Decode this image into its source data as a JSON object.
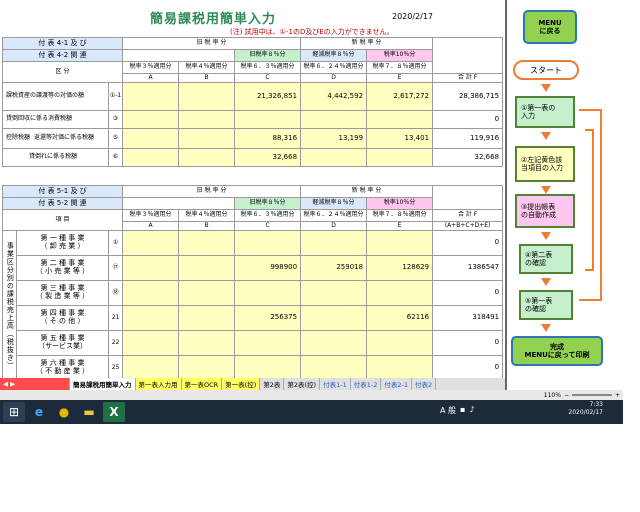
{
  "header": {
    "title": "簡易課税用簡単入力",
    "date": "2020/2/17",
    "note": "(注) 試用中は、①-1のD及びEの入力ができません。"
  },
  "table1": {
    "label_top": "付 表 4-1 及 び",
    "label_bottom": "付 表 4-2 関 連",
    "old_rate": "旧 税 率 分",
    "new_rate": "新 税 率 分",
    "old8": "旧税率８％分",
    "reduced8": "軽減税率８％分",
    "rate10": "税率10％分",
    "kubun": "区 分",
    "cols": [
      {
        "label": "税率３％適用分",
        "letter": "A"
      },
      {
        "label": "税率４％適用分",
        "letter": "B"
      },
      {
        "label": "税率６．３％適用分",
        "letter": "C"
      },
      {
        "label": "税率６．２４％適用分",
        "letter": "D"
      },
      {
        "label": "税率７．８％適用分",
        "letter": "E"
      },
      {
        "label": "合 計 F",
        "letter": "(A+B+C+D+E)"
      }
    ],
    "rows": [
      {
        "label": "課税資産の譲渡等の対価の額",
        "no": "①-1",
        "values": [
          "",
          "",
          "21,326,851",
          "4,442,592",
          "2,617,272",
          "28,386,715"
        ]
      },
      {
        "label": "貸倒回収に係る消費税額",
        "no": "③",
        "values": [
          "",
          "",
          "",
          "",
          "",
          "0"
        ]
      },
      {
        "label": "返還等対価に係る税額",
        "no": "⑤",
        "values": [
          "",
          "",
          "88,316",
          "13,199",
          "13,401",
          "119,916"
        ]
      },
      {
        "label": "貸倒れに係る税額",
        "no": "⑥",
        "values": [
          "",
          "",
          "32,668",
          "",
          "",
          "32,668"
        ]
      }
    ],
    "kojo": "控除税額"
  },
  "table2": {
    "label_top": "付 表 5-1 及 び",
    "label_bottom": "付 表 5-2 関 連",
    "kou": "項 目",
    "side_label": "事業区分別の課税売上高（税抜き）",
    "rows": [
      {
        "label1": "第 一 種 事 業",
        "label2": "（ 卸 売 業 ）",
        "no": "①",
        "values": [
          "",
          "",
          "",
          "",
          "",
          "0"
        ]
      },
      {
        "label1": "第 二 種 事 業",
        "label2": "（ 小 売 業 等 ）",
        "no": "⑰",
        "values": [
          "",
          "",
          "998900",
          "259018",
          "128629",
          "1386547"
        ]
      },
      {
        "label1": "第 三 種 事 業",
        "label2": "（ 製 造 業 等 ）",
        "no": "⑱",
        "values": [
          "",
          "",
          "",
          "",
          "",
          "0"
        ]
      },
      {
        "label1": "第 四 種 事 業",
        "label2": "（ そ の 他 ）",
        "no": "21",
        "values": [
          "",
          "",
          "256375",
          "",
          "62116",
          "318491"
        ]
      },
      {
        "label1": "第 五 種 事 業",
        "label2": "（サービス業）",
        "no": "22",
        "values": [
          "",
          "",
          "",
          "",
          "",
          "0"
        ]
      },
      {
        "label1": "第 六 種 事 業",
        "label2": "（ 不 動 産 業 ）",
        "no": "25",
        "values": [
          "",
          "",
          "",
          "",
          "",
          "0"
        ]
      }
    ]
  },
  "panel": {
    "menu_btn": "MENU\nに戻る",
    "start": "スタート",
    "step1": "①第一表の\n入力",
    "step2": "②左記黄色該\n当項目の入力",
    "step3": "③提出帳表\nの自動作成",
    "step4": "④第二表\nの確認",
    "step5": "⑤第一表\nの確認",
    "finish_btn": "完成\nMENUに戻って印刷"
  },
  "tabs": [
    "簡易課税用簡単入力",
    "第一表入力用",
    "第一表OCR",
    "第一表(控)",
    "第2表",
    "第2表(控)",
    "付表1-1",
    "付表1-2",
    "付表2-1",
    "付表2"
  ],
  "status": {
    "zoom": "110%"
  },
  "taskbar": {
    "time": "7:33",
    "date": "2020/02/17",
    "ime": "A 般"
  }
}
